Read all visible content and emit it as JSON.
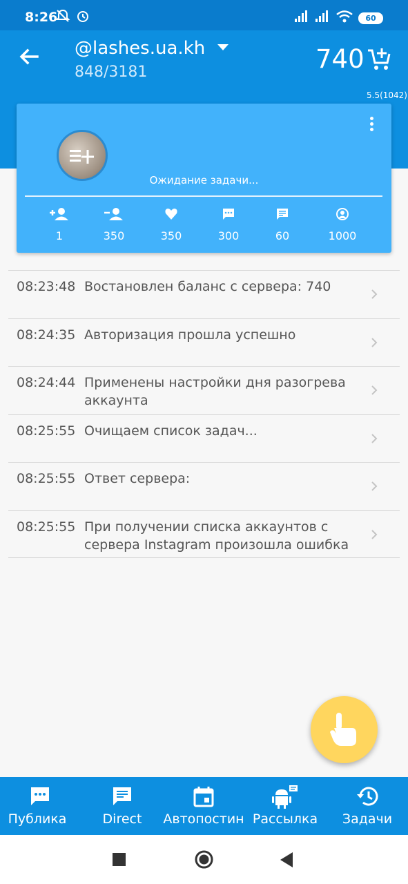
{
  "status_bar": {
    "time": "8:26",
    "battery": "60"
  },
  "app_bar": {
    "account": "@lashes.ua.kh",
    "count": "848/3181",
    "balance": "740",
    "version": "5.5(1042)"
  },
  "card": {
    "status": "Ожидание задачи...",
    "stats": [
      {
        "icon": "follow-icon",
        "value": "1"
      },
      {
        "icon": "unfollow-icon",
        "value": "350"
      },
      {
        "icon": "heart-icon",
        "value": "350"
      },
      {
        "icon": "comment-icon",
        "value": "300"
      },
      {
        "icon": "message-icon",
        "value": "60"
      },
      {
        "icon": "stories-icon",
        "value": "1000"
      }
    ]
  },
  "log": [
    {
      "time": "08:23:48",
      "text": "Востановлен баланс с сервера: 740"
    },
    {
      "time": "08:24:35",
      "text": "Авторизация прошла успешно"
    },
    {
      "time": "08:24:44",
      "text": "Применены настройки дня разогрева аккаунта"
    },
    {
      "time": "08:25:55",
      "text": "Очищаем список задач..."
    },
    {
      "time": "08:25:55",
      "text": "Ответ сервера:"
    },
    {
      "time": "08:25:55",
      "text": "При получении списка аккаунтов с сервера Instagram произошла ошибка"
    }
  ],
  "bottom_nav": [
    {
      "label": "Публика",
      "icon": "chat-bubble-icon"
    },
    {
      "label": "Direct",
      "icon": "message-icon"
    },
    {
      "label": "Автопостин",
      "icon": "calendar-icon"
    },
    {
      "label": "Рассылка",
      "icon": "android-icon"
    },
    {
      "label": "Задачи",
      "icon": "history-icon"
    }
  ]
}
